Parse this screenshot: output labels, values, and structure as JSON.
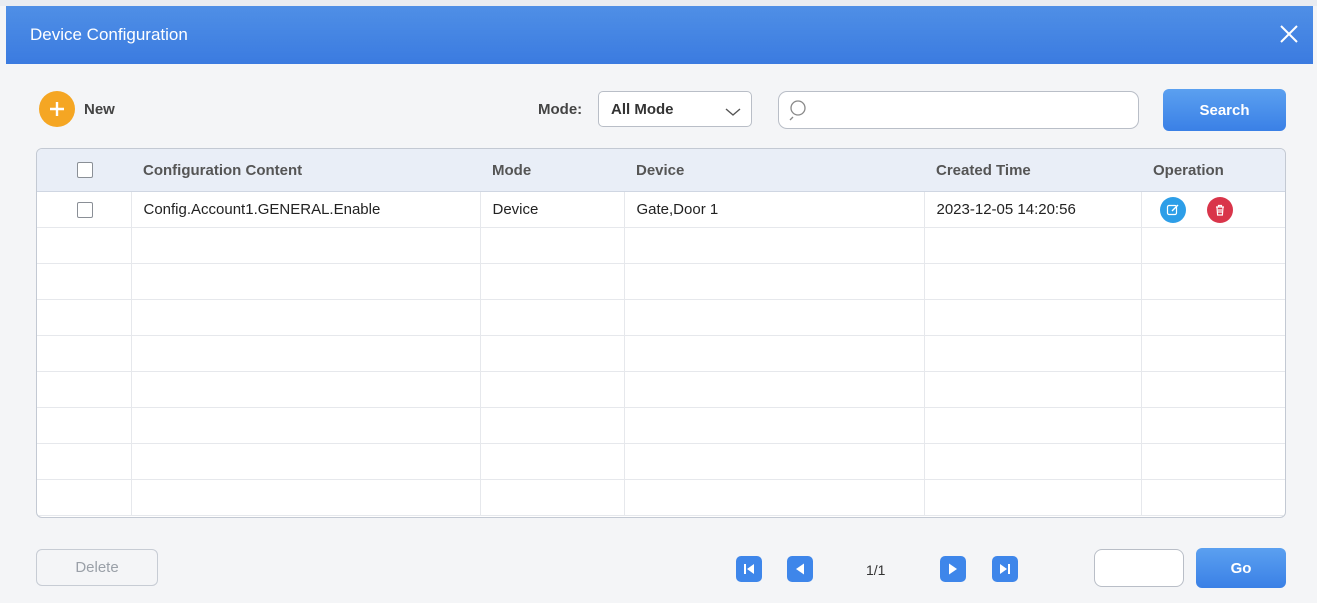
{
  "dialog": {
    "title": "Device Configuration"
  },
  "toolbar": {
    "new_label": "New",
    "mode_label": "Mode:",
    "mode_value": "All Mode",
    "search_placeholder": "",
    "search_label": "Search"
  },
  "table": {
    "headers": [
      "Configuration Content",
      "Mode",
      "Device",
      "Created Time",
      "Operation"
    ],
    "rows": [
      {
        "content": "Config.Account1.GENERAL.Enable",
        "mode": "Device",
        "device": "Gate,Door 1",
        "created": "2023-12-05 14:20:56"
      }
    ]
  },
  "footer": {
    "delete_label": "Delete",
    "page": "1/1",
    "go_label": "Go"
  },
  "colors": {
    "accent": "#3a80e6",
    "new": "#f5a623",
    "edit": "#2d9ee8",
    "delete": "#d9354a"
  },
  "icons": [
    "close-icon",
    "plus-icon",
    "chevron-down-icon",
    "search-icon",
    "edit-icon",
    "trash-icon",
    "first-page-icon",
    "prev-page-icon",
    "next-page-icon",
    "last-page-icon"
  ]
}
